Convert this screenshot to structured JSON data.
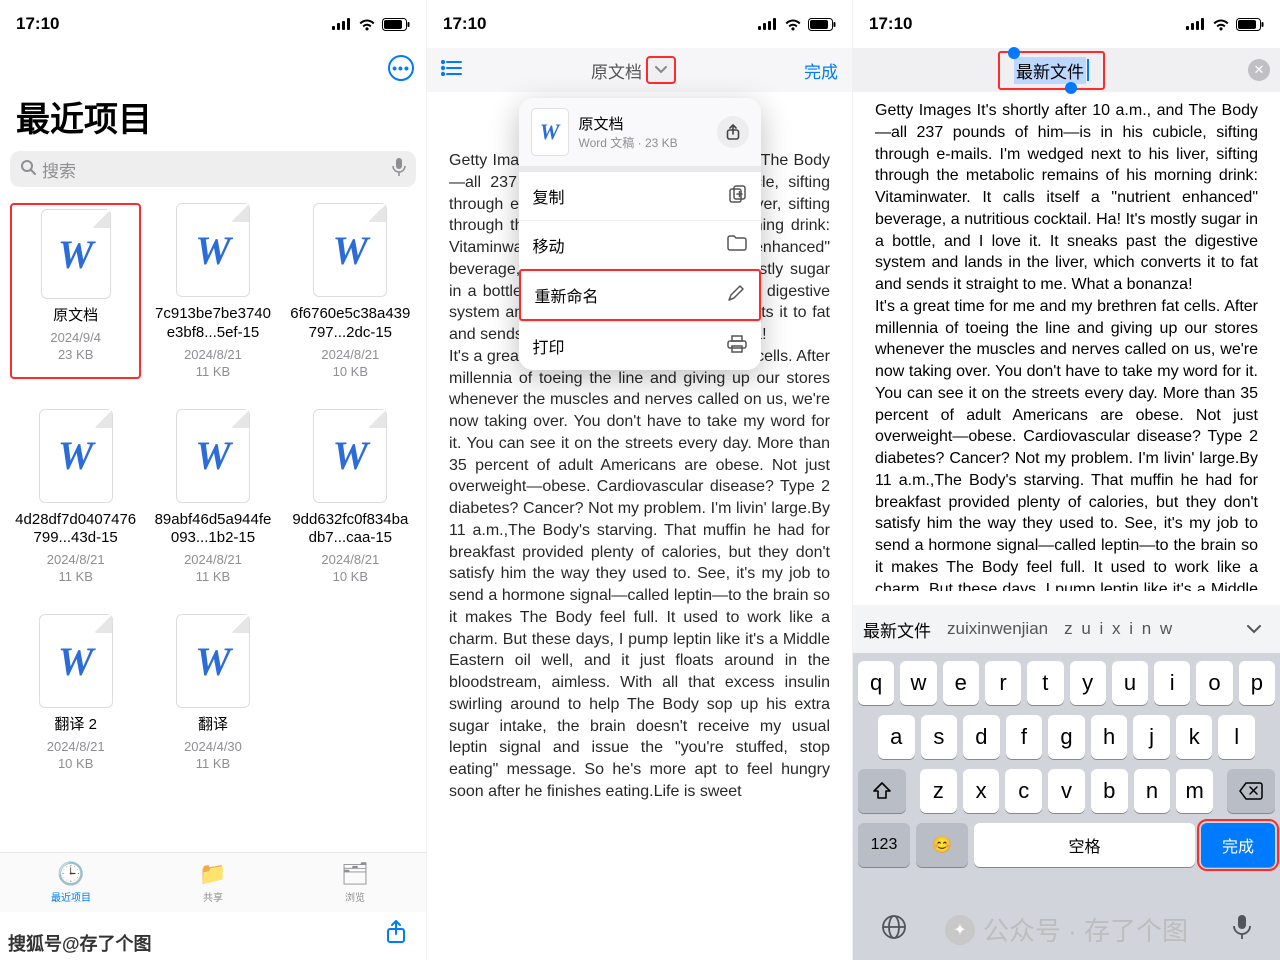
{
  "status": {
    "time": "17:10"
  },
  "panel1": {
    "title": "最近项目",
    "search_placeholder": "搜索",
    "files": [
      {
        "name": "原文档",
        "date": "2024/9/4",
        "size": "23 KB"
      },
      {
        "name": "7c913be7be3740e3bf8...5ef-15",
        "date": "2024/8/21",
        "size": "11 KB"
      },
      {
        "name": "6f6760e5c38a439797...2dc-15",
        "date": "2024/8/21",
        "size": "10 KB"
      },
      {
        "name": "4d28df7d0407476799...43d-15",
        "date": "2024/8/21",
        "size": "11 KB"
      },
      {
        "name": "89abf46d5a944fe093...1b2-15",
        "date": "2024/8/21",
        "size": "11 KB"
      },
      {
        "name": "9dd632fc0f834badb7...caa-15",
        "date": "2024/8/21",
        "size": "10 KB"
      },
      {
        "name": "翻译 2",
        "date": "2024/8/21",
        "size": "10 KB"
      },
      {
        "name": "翻译",
        "date": "2024/4/30",
        "size": "11 KB"
      }
    ],
    "tabs": {
      "recent": "最近项目",
      "shared": "共享",
      "browse": "浏览"
    }
  },
  "panel2": {
    "title": "原文档",
    "done": "完成",
    "popup": {
      "title": "原文档",
      "subtitle": "Word 文稿 · 23 KB",
      "copy": "复制",
      "move": "移动",
      "rename": "重新命名",
      "print": "打印"
    }
  },
  "panel3": {
    "rename_value": "最新文件",
    "candidates": {
      "c0": "最新文件",
      "c1": "zuixinwenjian",
      "c2": "z u i x i n w"
    },
    "keys": {
      "r1": [
        "q",
        "w",
        "e",
        "r",
        "t",
        "y",
        "u",
        "i",
        "o",
        "p"
      ],
      "r2": [
        "a",
        "s",
        "d",
        "f",
        "g",
        "h",
        "j",
        "k",
        "l"
      ],
      "r3": [
        "z",
        "x",
        "c",
        "v",
        "b",
        "n",
        "m"
      ],
      "num": "123",
      "space": "空格",
      "done": "完成"
    }
  },
  "document_para1": "Getty Images It's shortly after 10 a.m., and The Body—all 237 pounds of him—is in his cubicle, sifting through e-mails. I'm wedged next to his liver, sifting through the metabolic remains of his morning drink: Vitaminwater. It calls itself a \"nutrient enhanced\" beverage, a nutritious cocktail. Ha! It's mostly sugar in a bottle, and I love it. It sneaks past the digestive system and lands in the liver, which converts it to fat and sends it straight to me. What a bonanza!",
  "document_para2": "It's a great time for me and my brethren fat cells. After millennia of toeing the line and giving up our stores whenever the muscles and nerves called on us, we're now taking over. You don't have to take my word for it. You can see it on the streets every day. More than 35 percent of adult Americans are obese. Not just overweight—obese. Cardiovascular disease? Type 2 diabetes? Cancer? Not my problem. I'm livin' large.By 11 a.m.,The Body's starving. That muffin he had for breakfast provided plenty of calories, but they don't satisfy him the way they used to. See, it's my job to send a hormone signal—called leptin—to the brain so it makes The Body feel full. It used to work like a charm. But these days, I pump leptin like it's a Middle Eastern oil well, and it just floats around in the bloodstream, aimless. With all that excess insulin swirling around to help The Body sop up his extra sugar intake, the brain doesn't receive my usual leptin signal and issue the \"you're stuffed, stop eating\" message. So he's more apt to feel hungry soon after he finishes eating.Life is sweet",
  "watermark": "搜狐号@存了个图",
  "promo": "公众号 · 存了个图"
}
